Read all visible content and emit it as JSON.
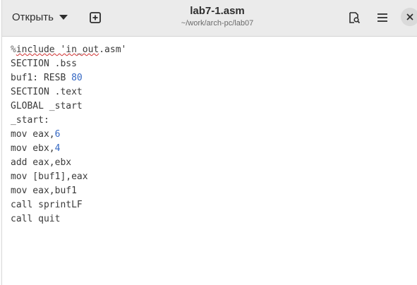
{
  "header": {
    "open_label": "Открыть",
    "title": "lab7-1.asm",
    "subtitle": "~/work/arch-pc/lab07"
  },
  "icons": {
    "new_tab": "plus-square-icon",
    "search": "search-document-icon",
    "menu": "hamburger-menu-icon",
    "close": "close-icon",
    "open_dropdown": "chevron-down-icon"
  },
  "colors": {
    "titlebar": "#ebebeb",
    "editor_bg": "#ffffff",
    "text": "#3a3a3a",
    "number": "#3568c3",
    "spell_underline": "#d03030"
  },
  "editor": {
    "lines": [
      [
        {
          "t": "%",
          "c": "pct"
        },
        {
          "t": "include 'in_out",
          "c": "str-sq"
        },
        {
          "t": ".asm'",
          "c": ""
        }
      ],
      [
        {
          "t": "SECTION .bss",
          "c": ""
        }
      ],
      [
        {
          "t": "buf1: RESB ",
          "c": ""
        },
        {
          "t": "80",
          "c": "num"
        }
      ],
      [
        {
          "t": "SECTION .text",
          "c": ""
        }
      ],
      [
        {
          "t": "GLOBAL _start",
          "c": ""
        }
      ],
      [
        {
          "t": "_start:",
          "c": ""
        }
      ],
      [
        {
          "t": "mov eax,",
          "c": ""
        },
        {
          "t": "6",
          "c": "num"
        }
      ],
      [
        {
          "t": "mov ebx,",
          "c": ""
        },
        {
          "t": "4",
          "c": "num"
        }
      ],
      [
        {
          "t": "add eax,ebx",
          "c": ""
        }
      ],
      [
        {
          "t": "mov [buf1],eax",
          "c": ""
        }
      ],
      [
        {
          "t": "mov eax,buf1",
          "c": ""
        }
      ],
      [
        {
          "t": "call sprintLF",
          "c": ""
        }
      ],
      [
        {
          "t": "call quit",
          "c": ""
        }
      ]
    ]
  }
}
